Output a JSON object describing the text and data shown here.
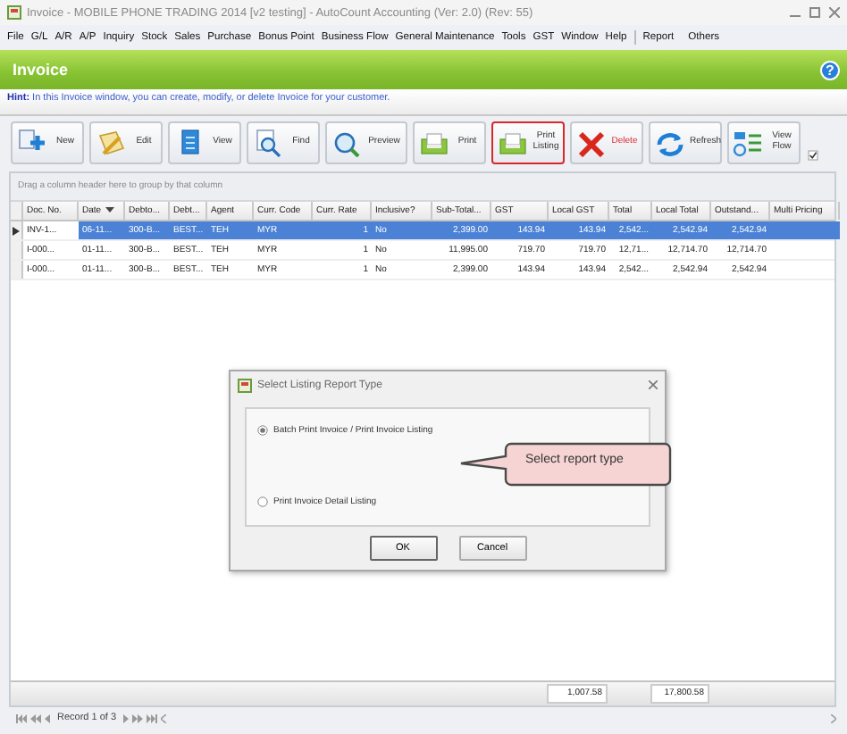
{
  "window": {
    "title": "Invoice - MOBILE PHONE TRADING 2014 [v2 testing] - AutoCount Accounting (Ver: 2.0) (Rev: 55)"
  },
  "menu": [
    "File",
    "G/L",
    "A/R",
    "A/P",
    "Inquiry",
    "Stock",
    "Sales",
    "Purchase",
    "Bonus Point",
    "Business Flow",
    "General Maintenance",
    "Tools",
    "GST",
    "Window",
    "Help",
    "Report",
    "Others"
  ],
  "header": {
    "title": "Invoice",
    "help": "?",
    "hint": "**Hint:** In this Invoice window, you can create, modify, or delete Invoice for your customer."
  },
  "toolbar": [
    {
      "kind": "new",
      "label": "New",
      "highlighted": false
    },
    {
      "kind": "edit",
      "label": "Edit",
      "highlighted": false
    },
    {
      "kind": "view",
      "label": "View",
      "highlighted": false
    },
    {
      "kind": "find",
      "label": "Find",
      "highlighted": false
    },
    {
      "kind": "preview",
      "label": "Preview",
      "highlighted": false
    },
    {
      "kind": "print",
      "label": "Print",
      "highlighted": false
    },
    {
      "kind": "print",
      "label": "Print Listing",
      "highlighted": true
    },
    {
      "kind": "delete",
      "label": "Delete",
      "highlighted": false
    },
    {
      "kind": "refresh",
      "label": "Refresh",
      "highlighted": false
    },
    {
      "kind": "flow",
      "label": "View Flow",
      "highlighted": false
    }
  ],
  "toolbar_option": {
    "checked": true
  },
  "group_hint": "Drag a column header here to group by that column",
  "table": {
    "columns": [
      "Doc. No.",
      "Date",
      "Debto...",
      "Debt...",
      "Agent",
      "Curr. Code",
      "Curr. Rate",
      "Inclusive?",
      "Sub-Total...",
      "GST",
      "Local GST",
      "Total",
      "Local Total",
      "Outstand...",
      "Multi Pricing"
    ],
    "rows": [
      {
        "selected": true,
        "cells": [
          "INV-1...",
          "06-11...",
          "300-B...",
          "BEST...",
          "TEH",
          "MYR",
          "1",
          "No",
          "2,399.00",
          "143.94",
          "143.94",
          "2,542...",
          "2,542.94",
          "2,542.94",
          ""
        ]
      },
      {
        "selected": false,
        "cells": [
          "I-000...",
          "01-11...",
          "300-B...",
          "BEST...",
          "TEH",
          "MYR",
          "1",
          "No",
          "11,995.00",
          "719.70",
          "719.70",
          "12,71...",
          "12,714.70",
          "12,714.70",
          ""
        ]
      },
      {
        "selected": false,
        "cells": [
          "I-000...",
          "01-11...",
          "300-B...",
          "BEST...",
          "TEH",
          "MYR",
          "1",
          "No",
          "2,399.00",
          "143.94",
          "143.94",
          "2,542...",
          "2,542.94",
          "2,542.94",
          ""
        ]
      }
    ],
    "footer": {
      "local_gst": "1,007.58",
      "local_total": "17,800.58"
    }
  },
  "navigator": {
    "record": "Record 1 of 3"
  },
  "dialog": {
    "title": "Select Listing Report Type",
    "options": [
      {
        "label": "Batch Print Invoice / Print Invoice Listing",
        "selected": true
      },
      {
        "label": "Print Invoice Detail Listing",
        "selected": false
      }
    ],
    "callout": "Select report type",
    "buttons": [
      "OK",
      "Cancel"
    ]
  }
}
